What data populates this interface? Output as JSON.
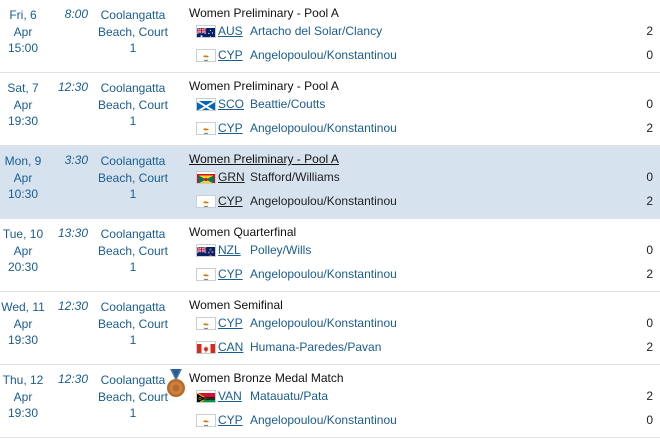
{
  "matches": [
    {
      "date": [
        "Fri, 6 Apr",
        "15:00"
      ],
      "time": "8:00",
      "venue": [
        "Coolangatta",
        "Beach, Court",
        "1"
      ],
      "event": "Women Preliminary - Pool A",
      "medal": false,
      "highlight": false,
      "teams": [
        {
          "flag": "AUS",
          "code": "AUS",
          "players": "Artacho del Solar/Clancy",
          "score": "2"
        },
        {
          "flag": "CYP",
          "code": "CYP",
          "players": "Angelopoulou/Konstantinou",
          "score": "0"
        }
      ]
    },
    {
      "date": [
        "Sat, 7",
        "Apr",
        "19:30"
      ],
      "time": "12:30",
      "venue": [
        "Coolangatta",
        "Beach, Court",
        "1"
      ],
      "event": "Women Preliminary - Pool A",
      "medal": false,
      "highlight": false,
      "teams": [
        {
          "flag": "SCO",
          "code": "SCO",
          "players": "Beattie/Coutts",
          "score": "0"
        },
        {
          "flag": "CYP",
          "code": "CYP",
          "players": "Angelopoulou/Konstantinou",
          "score": "2"
        }
      ]
    },
    {
      "date": [
        "Mon, 9",
        "Apr",
        "10:30"
      ],
      "time": "3:30",
      "venue": [
        "Coolangatta",
        "Beach, Court",
        "1"
      ],
      "event": "Women Preliminary - Pool A",
      "medal": false,
      "highlight": true,
      "teams": [
        {
          "flag": "GRN",
          "code": "GRN",
          "players": "Stafford/Williams",
          "score": "0"
        },
        {
          "flag": "CYP",
          "code": "CYP",
          "players": "Angelopoulou/Konstantinou",
          "score": "2"
        }
      ]
    },
    {
      "date": [
        "Tue, 10",
        "Apr",
        "20:30"
      ],
      "time": "13:30",
      "venue": [
        "Coolangatta",
        "Beach, Court",
        "1"
      ],
      "event": "Women Quarterfinal",
      "medal": false,
      "highlight": false,
      "teams": [
        {
          "flag": "NZL",
          "code": "NZL",
          "players": "Polley/Wills",
          "score": "0"
        },
        {
          "flag": "CYP",
          "code": "CYP",
          "players": "Angelopoulou/Konstantinou",
          "score": "2"
        }
      ]
    },
    {
      "date": [
        "Wed, 11",
        "Apr",
        "19:30"
      ],
      "time": "12:30",
      "venue": [
        "Coolangatta",
        "Beach, Court",
        "1"
      ],
      "event": "Women Semifinal",
      "medal": false,
      "highlight": false,
      "teams": [
        {
          "flag": "CYP",
          "code": "CYP",
          "players": "Angelopoulou/Konstantinou",
          "score": "0"
        },
        {
          "flag": "CAN",
          "code": "CAN",
          "players": "Humana-Paredes/Pavan",
          "score": "2"
        }
      ]
    },
    {
      "date": [
        "Thu, 12",
        "Apr",
        "19:30"
      ],
      "time": "12:30",
      "venue": [
        "Coolangatta",
        "Beach, Court",
        "1"
      ],
      "event": "Women Bronze Medal Match",
      "medal": true,
      "highlight": false,
      "teams": [
        {
          "flag": "VAN",
          "code": "VAN",
          "players": "Matauatu/Pata",
          "score": "2"
        },
        {
          "flag": "CYP",
          "code": "CYP",
          "players": "Angelopoulou/Konstantinou",
          "score": "0"
        }
      ]
    }
  ],
  "colors": {
    "link": "#1a5d8f",
    "highlight": "#d6e3ee",
    "divider": "#dfe3e8"
  }
}
